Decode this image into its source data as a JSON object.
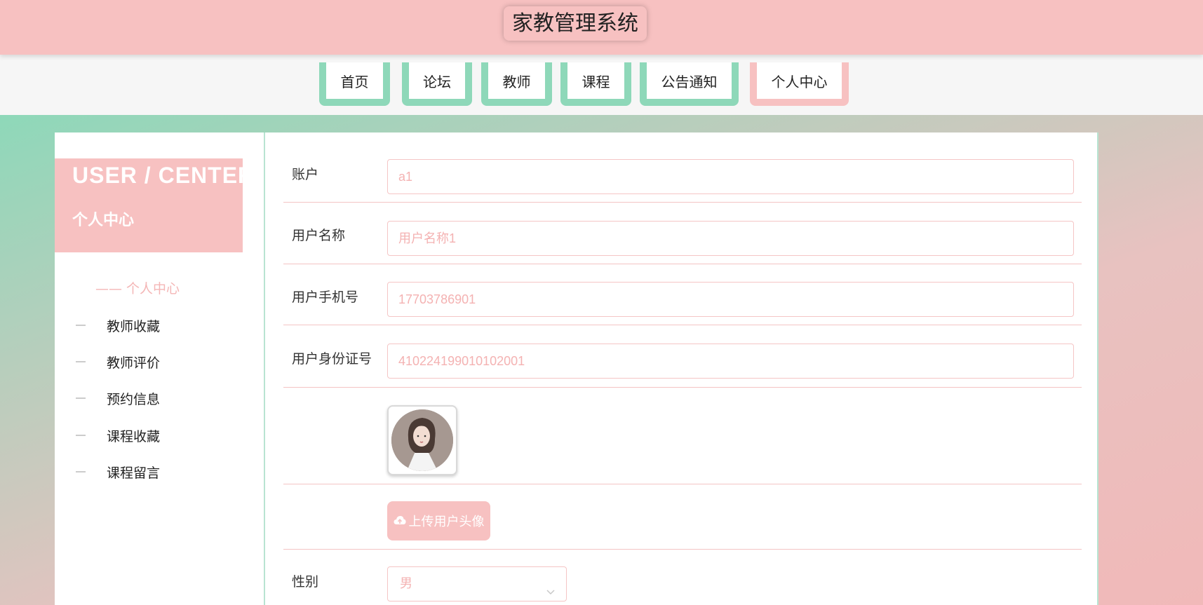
{
  "header": {
    "title": "家教管理系统"
  },
  "nav": {
    "items": [
      {
        "label": "首页"
      },
      {
        "label": "论坛"
      },
      {
        "label": "教师"
      },
      {
        "label": "课程"
      },
      {
        "label": "公告通知"
      },
      {
        "label": "个人中心"
      }
    ],
    "active": "个人中心"
  },
  "sidebar": {
    "title_en": "USER / CENTER",
    "title_cn": "个人中心",
    "active_label": "—— 个人中心",
    "items": [
      {
        "label": "教师收藏"
      },
      {
        "label": "教师评价"
      },
      {
        "label": "预约信息"
      },
      {
        "label": "课程收藏"
      },
      {
        "label": "课程留言"
      }
    ]
  },
  "form": {
    "account": {
      "label": "账户",
      "value": "a1"
    },
    "username": {
      "label": "用户名称",
      "value": "用户名称1"
    },
    "phone": {
      "label": "用户手机号",
      "value": "17703786901"
    },
    "id_card": {
      "label": "用户身份证号",
      "value": "410224199010102001"
    },
    "avatar": {
      "alt": "用户头像"
    },
    "upload": {
      "label": "上传用户头像",
      "icon": "cloud-upload-icon"
    },
    "gender": {
      "label": "性别",
      "value": "男"
    }
  },
  "colors": {
    "pink": "#f7c1c1",
    "green": "#8ed8b9",
    "input_text": "#f4b2b2"
  }
}
